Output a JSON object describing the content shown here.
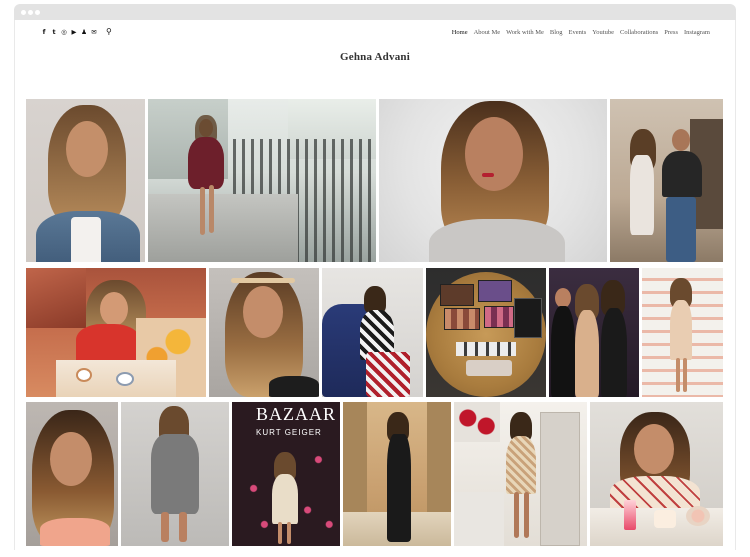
{
  "header": {
    "social_icons": [
      {
        "name": "facebook-icon",
        "glyph": "f"
      },
      {
        "name": "twitter-icon",
        "glyph": "t"
      },
      {
        "name": "instagram-icon",
        "glyph": "◎"
      },
      {
        "name": "youtube-icon",
        "glyph": "▶"
      },
      {
        "name": "snapchat-icon",
        "glyph": "♟"
      },
      {
        "name": "email-icon",
        "glyph": "✉"
      }
    ],
    "search_icon": "⚲",
    "nav": [
      {
        "label": "Home",
        "active": true
      },
      {
        "label": "About Me",
        "active": false
      },
      {
        "label": "Work with Me",
        "active": false
      },
      {
        "label": "Blog",
        "active": false
      },
      {
        "label": "Events",
        "active": false
      },
      {
        "label": "Youtube",
        "active": false
      },
      {
        "label": "Collaborations",
        "active": false
      },
      {
        "label": "Press",
        "active": false
      },
      {
        "label": "Instagram",
        "active": false
      }
    ]
  },
  "site": {
    "title": "Gehna Advani"
  },
  "gallery": {
    "photo_texts": {
      "bazaar": "BAZAAR",
      "kurt_geiger": "KURT GEIGER"
    }
  },
  "colors": {
    "text_dark": "#111111",
    "nav_text": "#555555",
    "title_text": "#333333",
    "chrome": "#e3e3e3"
  }
}
